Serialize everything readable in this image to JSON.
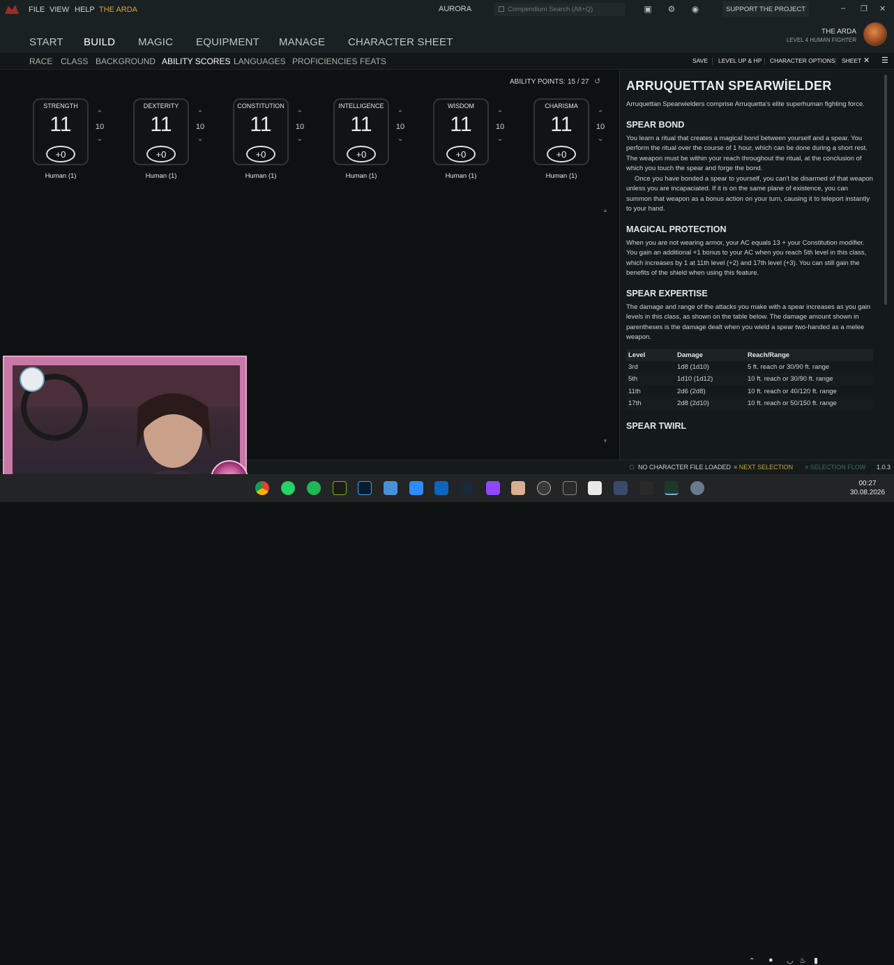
{
  "titlebar": {
    "menu": [
      "FILE",
      "VIEW",
      "HELP",
      "THE ARDA"
    ],
    "app_title": "AURORA",
    "search_placeholder": "Compendium Search  (Alt+Q)",
    "support_label": "SUPPORT THE PROJECT",
    "icons": [
      "layout-icon",
      "gear-icon",
      "globe-icon"
    ]
  },
  "mainnav": {
    "items": [
      "START",
      "BUILD",
      "MAGIC",
      "EQUIPMENT",
      "MANAGE",
      "CHARACTER SHEET"
    ],
    "active": "BUILD",
    "character_name": "THE ARDA",
    "character_level": "LEVEL 4 HUMAN FIGHTER"
  },
  "subnav": {
    "items": [
      "RACE",
      "CLASS",
      "BACKGROUND",
      "ABILITY SCORES",
      "LANGUAGES",
      "PROFICIENCIES",
      "FEATS"
    ],
    "active": "ABILITY SCORES",
    "right": [
      "SAVE",
      "LEVEL UP & HP",
      "CHARACTER OPTIONS",
      "SHEET"
    ]
  },
  "ability_points": {
    "label": "ABILITY POINTS:",
    "value": "15 / 27"
  },
  "abilities": [
    {
      "name": "STRENGTH",
      "score": "11",
      "base": "10",
      "modifier": "+0",
      "source": "Human (1)"
    },
    {
      "name": "DEXTERITY",
      "score": "11",
      "base": "10",
      "modifier": "+0",
      "source": "Human (1)"
    },
    {
      "name": "CONSTITUTION",
      "score": "11",
      "base": "10",
      "modifier": "+0",
      "source": "Human (1)"
    },
    {
      "name": "INTELLIGENCE",
      "score": "11",
      "base": "10",
      "modifier": "+0",
      "source": "Human (1)"
    },
    {
      "name": "WISDOM",
      "score": "11",
      "base": "10",
      "modifier": "+0",
      "source": "Human (1)"
    },
    {
      "name": "CHARISMA",
      "score": "11",
      "base": "10",
      "modifier": "+0",
      "source": "Human (1)"
    }
  ],
  "panel": {
    "title": "ARRUQUETTAN SPEARWİELDER",
    "intro": "Arruquettan Spearwielders comprise Arruquetta's elite superhuman fighting force.",
    "sections": [
      {
        "heading": "SPEAR BOND",
        "paragraphs": [
          "You learn a ritual that creates a magical bond between yourself and a spear. You perform the ritual over the course of 1 hour, which can be done during a short rest. The weapon must be within your reach throughout the ritual, at the conclusion of which you touch the spear and forge the bond.",
          "Once you have bonded a spear to yourself, you can't be disarmed of that weapon unless you are incapaciated. If it is on the same plane of existence, you can summon that weapon as a bonus action on your turn, causing it to teleport instantly to your hand."
        ]
      },
      {
        "heading": "MAGICAL PROTECTION",
        "paragraphs": [
          "When you are not wearing armor, your AC equals 13 + your Constitution modifier. You gain an additional +1 bonus to your AC when you reach 5th level in this class, which increases by 1 at 11th level (+2) and 17th level (+3). You can still gain the benefits of the shield when using this feature."
        ]
      },
      {
        "heading": "SPEAR EXPERTISE",
        "paragraphs": [
          "The damage and range of the attacks you make with a spear increases as you gain levels in this class, as shown on the table below. The damage amount shown in parentheses is the damage dealt when you wield a spear two-handed as a melee weapon."
        ]
      }
    ],
    "table": {
      "headers": [
        "Level",
        "Damage",
        "Reach/Range"
      ],
      "rows": [
        [
          "3rd",
          "1d8 (1d10)",
          "5 ft. reach or 30/90 ft. range"
        ],
        [
          "5th",
          "1d10 (1d12)",
          "10 ft. reach or 30/90 ft. range"
        ],
        [
          "11th",
          "2d6 (2d8)",
          "10 ft. reach or 40/120 ft. range"
        ],
        [
          "17th",
          "2d8 (2d10)",
          "10 ft. reach or 50/150 ft. range"
        ]
      ]
    },
    "next_heading": "SPEAR TWIRL"
  },
  "statusbar": {
    "file_status": "NO CHARACTER FILE LOADED",
    "next_selection": "NEXT SELECTION",
    "selection_flow": "SELECTION FLOW",
    "version": "1.0.3"
  },
  "taskbar": {
    "time": "00:27",
    "date": "30.08.2026"
  },
  "colors": {
    "accent": "#d9a23e",
    "background": "#0f1213",
    "panel": "#141a1b",
    "status_warning": "#c9a43a"
  }
}
